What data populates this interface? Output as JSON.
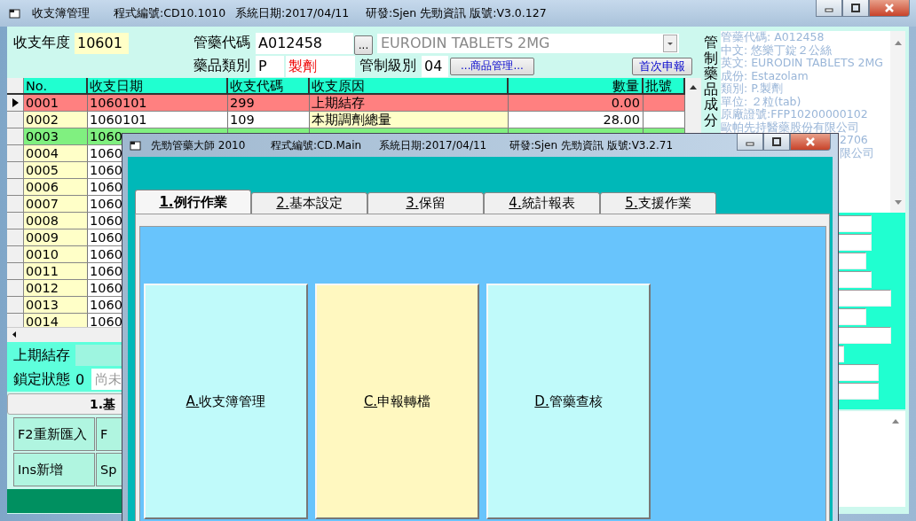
{
  "main_window": {
    "title": "收支簿管理",
    "program_id": "程式編號:CD10.1010",
    "system_date": "系統日期:2017/04/11",
    "version": "研發:Sjen 先勁資訊 版號:V3.0.127"
  },
  "header": {
    "year_label": "收支年度",
    "year": "10601",
    "code_label": "管藥代碼",
    "code": "A012458",
    "browse_button": "...",
    "drug_name": "EURODIN TABLETS 2MG",
    "category_label": "藥品類別",
    "category": "P",
    "category_name": "製劑",
    "grade_label": "管制級別",
    "grade": "04",
    "product_button": "...商品管理...",
    "declare_button": "首次申報"
  },
  "ingredients": {
    "heading": "管制藥品成分",
    "lines": [
      {
        "text": "管藥代碼: A012458",
        "kind": "full"
      },
      {
        "text": "中文: 悠樂丁錠２公絲",
        "kind": "full"
      },
      {
        "text": "英文: EURODIN TABLETS 2MG",
        "kind": "full"
      },
      {
        "text": "成份: Estazolam",
        "kind": "full"
      },
      {
        "text": "類別: P.製劑",
        "kind": "full"
      },
      {
        "text": "單位: ２粒(tab)",
        "kind": "full"
      },
      {
        "text": "原廠證號:FFP10200000102",
        "kind": "full"
      },
      {
        "text": "歐帕先持醫藥股份有限公司",
        "kind": "full"
      },
      {
        "text": "2706",
        "kind": "cut"
      },
      {
        "text": "限公司",
        "kind": "cut"
      }
    ]
  },
  "table": {
    "columns": [
      "No.",
      "收支日期",
      "收支代碼",
      "收支原因",
      "數量",
      "批號"
    ],
    "rows": [
      {
        "no": "0001",
        "date": "1060101",
        "code": "299",
        "reason": "上期結存",
        "qty": "0.00",
        "selected": true,
        "color": "#ff8080"
      },
      {
        "no": "0002",
        "date": "1060101",
        "code": "109",
        "reason": "本期調劑總量",
        "qty": "28.00",
        "selected": false
      },
      {
        "no": "0003",
        "date": "1060",
        "selected": false,
        "color": "#80f080"
      },
      {
        "no": "0004",
        "date": "1060",
        "selected": false
      },
      {
        "no": "0005",
        "date": "1060",
        "selected": false
      },
      {
        "no": "0006",
        "date": "1060",
        "selected": false
      },
      {
        "no": "0007",
        "date": "1060",
        "selected": false
      },
      {
        "no": "0008",
        "date": "1060",
        "selected": false
      },
      {
        "no": "0009",
        "date": "1060",
        "selected": false
      },
      {
        "no": "0010",
        "date": "1060",
        "selected": false
      },
      {
        "no": "0011",
        "date": "1060",
        "selected": false
      },
      {
        "no": "0012",
        "date": "1060",
        "selected": false
      },
      {
        "no": "0013",
        "date": "1060",
        "selected": false
      },
      {
        "no": "0014",
        "date": "1060",
        "selected": false
      }
    ]
  },
  "summary": {
    "carry_label": "上期結存",
    "lock_label": "鎖定狀態",
    "lock_value": "0",
    "lock_status": "尚未"
  },
  "section_tab": "1.基",
  "buttons": [
    {
      "label": "F2重新匯入"
    },
    {
      "label": "F"
    },
    {
      "label": "Ins新增"
    },
    {
      "label": "Sp"
    }
  ],
  "front_window": {
    "title": "先勁管藥大師 2010",
    "program_id": "程式編號:CD.Main",
    "system_date": "系統日期:2017/04/11",
    "version": "研發:Sjen 先勁資訊 版號:V3.2.71",
    "tabs": [
      {
        "label": "1.例行作業",
        "selected": true
      },
      {
        "label": "2.基本設定",
        "selected": false
      },
      {
        "label": "3.保留",
        "selected": false
      },
      {
        "label": "4.統計報表",
        "selected": false
      },
      {
        "label": "5.支援作業",
        "selected": false
      }
    ],
    "actions": [
      {
        "label": "A.收支簿管理",
        "color": "#c0fafa"
      },
      {
        "label": "C.申報轉檔",
        "color": "#fff8c0"
      },
      {
        "label": "D.管藥查核",
        "color": "#c0fafa"
      }
    ]
  }
}
